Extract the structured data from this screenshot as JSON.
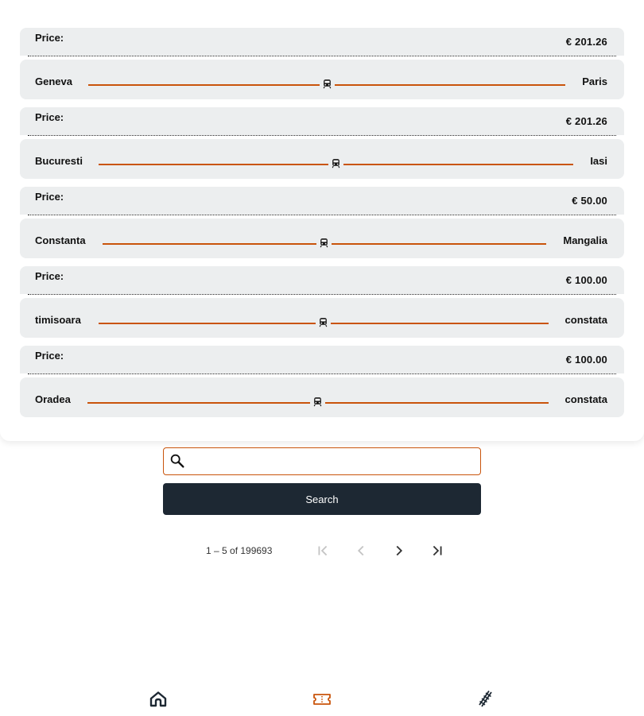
{
  "tickets": [
    {
      "price_label": "Price:",
      "price": "€ 201.26",
      "from": "Geneva",
      "to": "Paris"
    },
    {
      "price_label": "Price:",
      "price": "€ 201.26",
      "from": "Bucuresti",
      "to": "Iasi"
    },
    {
      "price_label": "Price:",
      "price": "€ 50.00",
      "from": "Constanta",
      "to": "Mangalia"
    },
    {
      "price_label": "Price:",
      "price": "€ 100.00",
      "from": "timisoara",
      "to": "constata"
    },
    {
      "price_label": "Price:",
      "price": "€ 100.00",
      "from": "Oradea",
      "to": "constata"
    }
  ],
  "search": {
    "placeholder": "",
    "value": "",
    "button_label": "Search"
  },
  "pagination": {
    "range_label": "1 – 5 of 199693"
  },
  "bottom_nav": {
    "items": [
      "home-icon",
      "ticket-icon",
      "railway-icon"
    ]
  },
  "colors": {
    "accent": "#c9540b",
    "card": "#eceeef",
    "button": "#1d2833"
  }
}
